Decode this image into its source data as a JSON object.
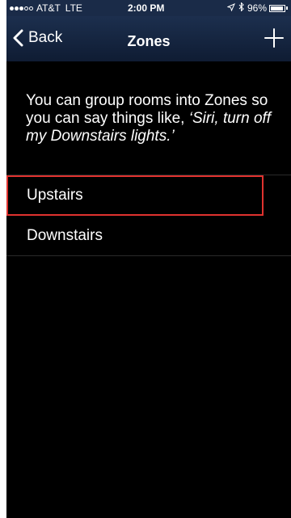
{
  "status_bar": {
    "carrier": "AT&T",
    "network": "LTE",
    "time": "2:00 PM",
    "battery_percent": "96%",
    "battery_level": 0.96,
    "signal_bars_filled": 3,
    "signal_bars_total": 5,
    "location_icon": "location-arrow-icon",
    "bluetooth_icon": "bluetooth-icon"
  },
  "nav": {
    "back_label": "Back",
    "title": "Zones",
    "add_icon": "plus-icon"
  },
  "description": {
    "plain": "You can group rooms into Zones so you can say things like, ",
    "italic": "‘Siri, turn off my Downstairs lights.’"
  },
  "zones": [
    {
      "label": "Upstairs",
      "highlighted": true
    },
    {
      "label": "Downstairs",
      "highlighted": false
    }
  ],
  "colors": {
    "background": "#000000",
    "nav_background": "#1a2b48",
    "text": "#ffffff",
    "highlight": "#e0322f"
  }
}
